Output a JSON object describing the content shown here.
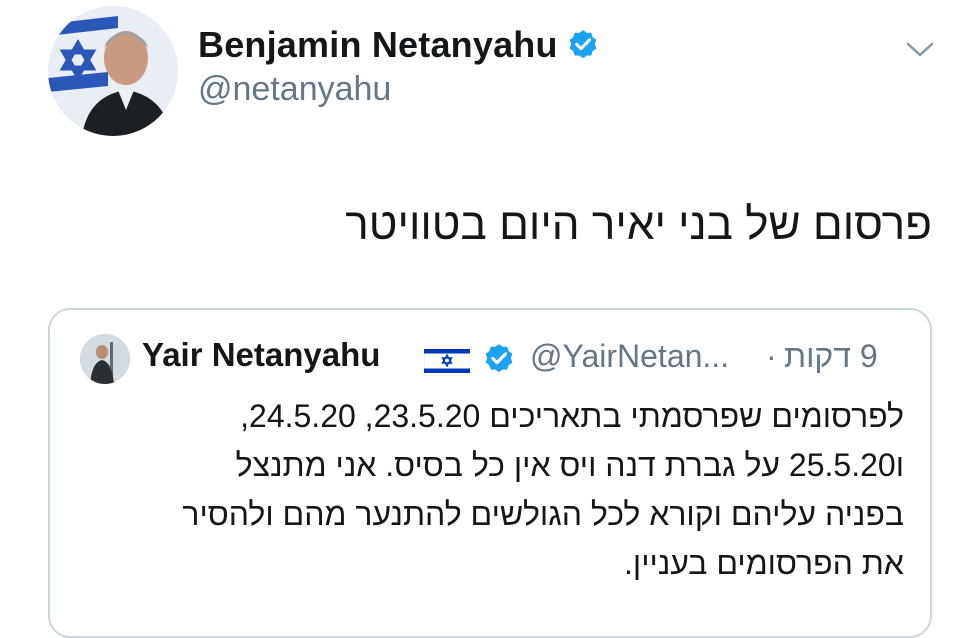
{
  "author": {
    "display_name": "Benjamin Netanyahu",
    "handle": "@netanyahu",
    "verified": true
  },
  "tweet": {
    "text": "פרסום של בני יאיר היום בטוויטר"
  },
  "quoted_tweet": {
    "display_name": "Yair Netanyahu",
    "flag_icon": "israel-flag-icon",
    "verified": true,
    "handle": "@YairNetan...",
    "separator": "·",
    "time": "9 דקות",
    "lines": [
      "לפרסומים שפרסמתי בתאריכים 23.5.20, 24.5.20,",
      "ו25.5.20 על גברת דנה ויס אין כל בסיס. אני מתנצל",
      "בפניה עליהם וקורא לכל הגולשים להתנער מהם ולהסיר",
      "את הפרסומים בעניין."
    ]
  },
  "colors": {
    "verified_blue": "#1da1f2",
    "secondary_text": "#657786",
    "primary_text": "#14171a",
    "border": "#ccd6dd",
    "flag_blue": "#0038b8"
  },
  "icons": {
    "verified": "verified-badge-icon",
    "menu": "chevron-down-icon"
  }
}
